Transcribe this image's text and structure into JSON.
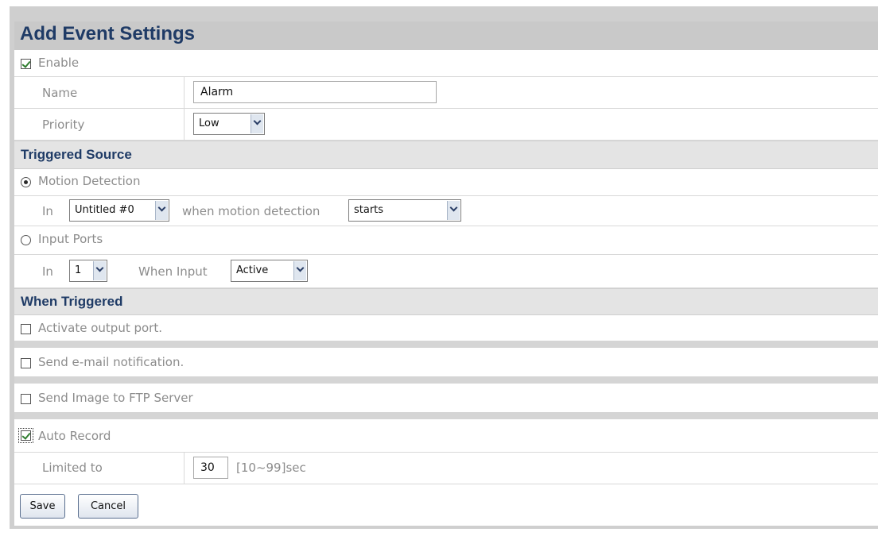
{
  "title": "Add Event Settings",
  "general": {
    "enable_label": "Enable",
    "enable_checked": true,
    "name_label": "Name",
    "name_value": "Alarm",
    "priority_label": "Priority",
    "priority_value": "Low"
  },
  "triggered_source": {
    "heading": "Triggered Source",
    "motion": {
      "label": "Motion Detection",
      "selected": true,
      "in_label": "In",
      "window_value": "Untitled #0",
      "when_label": "when motion detection",
      "when_value": "starts"
    },
    "input": {
      "label": "Input Ports",
      "selected": false,
      "in_label": "In",
      "port_value": "1",
      "when_label": "When Input",
      "when_value": "Active"
    }
  },
  "when_triggered": {
    "heading": "When Triggered",
    "activate_output": "Activate output port.",
    "send_email": "Send e-mail notification.",
    "send_ftp": "Send Image to FTP Server",
    "auto_record": "Auto Record",
    "auto_record_checked": true,
    "limited_label": "Limited to",
    "limited_value": "30",
    "limited_range": "[10~99]sec"
  },
  "buttons": {
    "save": "Save",
    "cancel": "Cancel"
  }
}
